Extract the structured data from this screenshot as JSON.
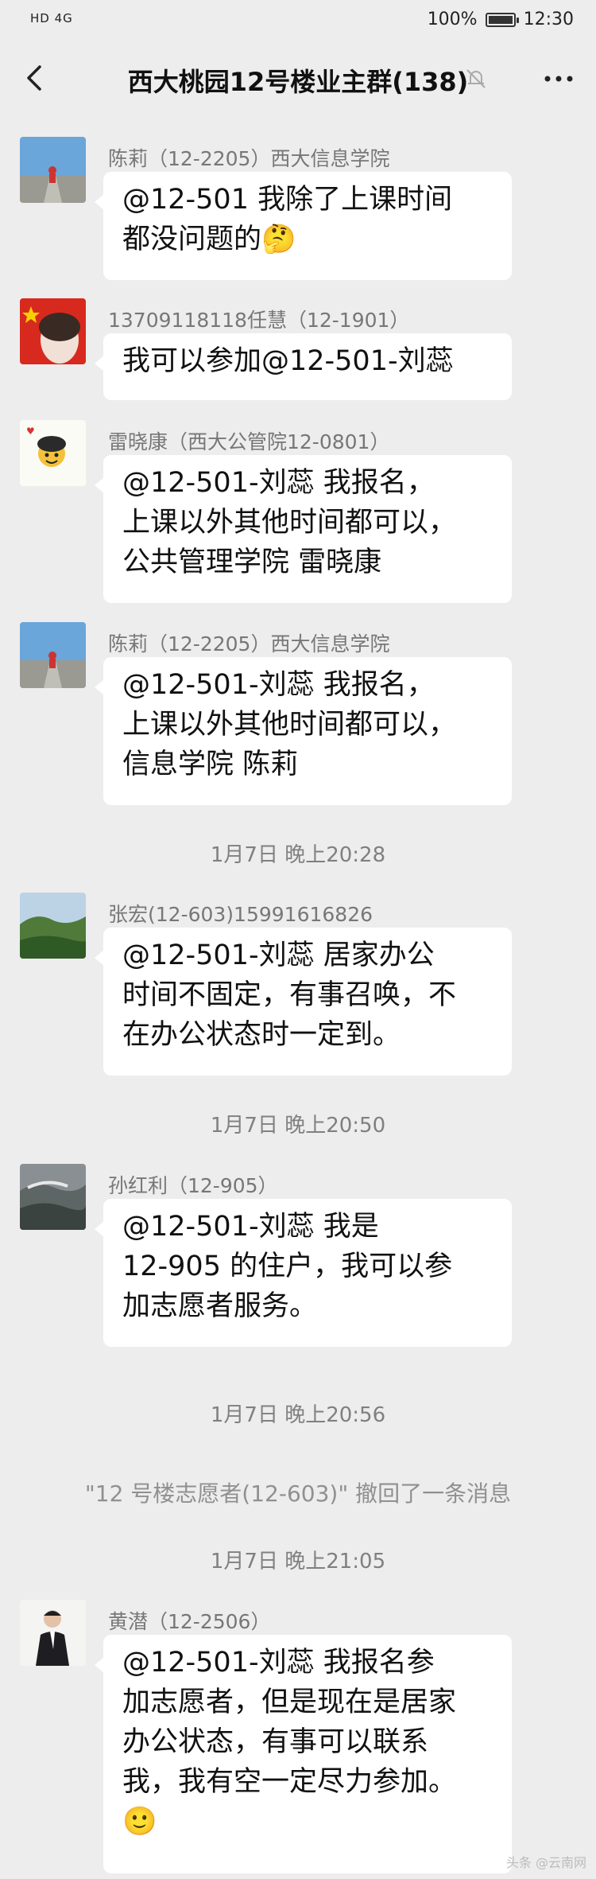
{
  "status_bar": {
    "network": "HD 4G",
    "battery_level": "100%",
    "battery_fraction": 1.0,
    "clock": "12:30"
  },
  "header": {
    "title": "西大桃园12号楼业主群(138)",
    "icons": [
      "back-arrow-icon",
      "mute-bell-icon",
      "more-icon"
    ]
  },
  "messages": [
    {
      "sender": "陈莉（12-2205）西大信息学院",
      "text": "@12-501  我除了上课时间\n都没问题的🤔"
    },
    {
      "sender": "13709118118任慧（12-1901）",
      "text": "我可以参加@12-501-刘蕊"
    },
    {
      "sender": "雷晓康（西大公管院12-0801）",
      "text": "@12-501-刘蕊  我报名，\n上课以外其他时间都可以，\n公共管理学院 雷晓康"
    },
    {
      "sender": "陈莉（12-2205）西大信息学院",
      "text": "@12-501-刘蕊  我报名，\n上课以外其他时间都可以，\n信息学院 陈莉"
    },
    {
      "sender": "张宏(12-603)15991616826",
      "text": "@12-501-刘蕊    居家办公\n时间不固定，有事召唤，不\n在办公状态时一定到。"
    },
    {
      "sender": "孙红利（12-905）",
      "text": "@12-501-刘蕊  我是\n12-905 的住户，我可以参\n加志愿者服务。"
    },
    {
      "sender": "黄潜（12-2506）",
      "text": "@12-501-刘蕊  我报名参\n加志愿者，但是现在是居家\n办公状态，有事可以联系\n我，我有空一定尽力参加。\n🙂"
    }
  ],
  "timestamps": [
    "1月7日 晚上20:28",
    "1月7日 晚上20:50",
    "1月7日 晚上20:56",
    "1月7日 晚上21:05"
  ],
  "system_notice": "\"12 号楼志愿者(12-603)\" 撤回了一条消息",
  "watermark": "头条 @云南网"
}
